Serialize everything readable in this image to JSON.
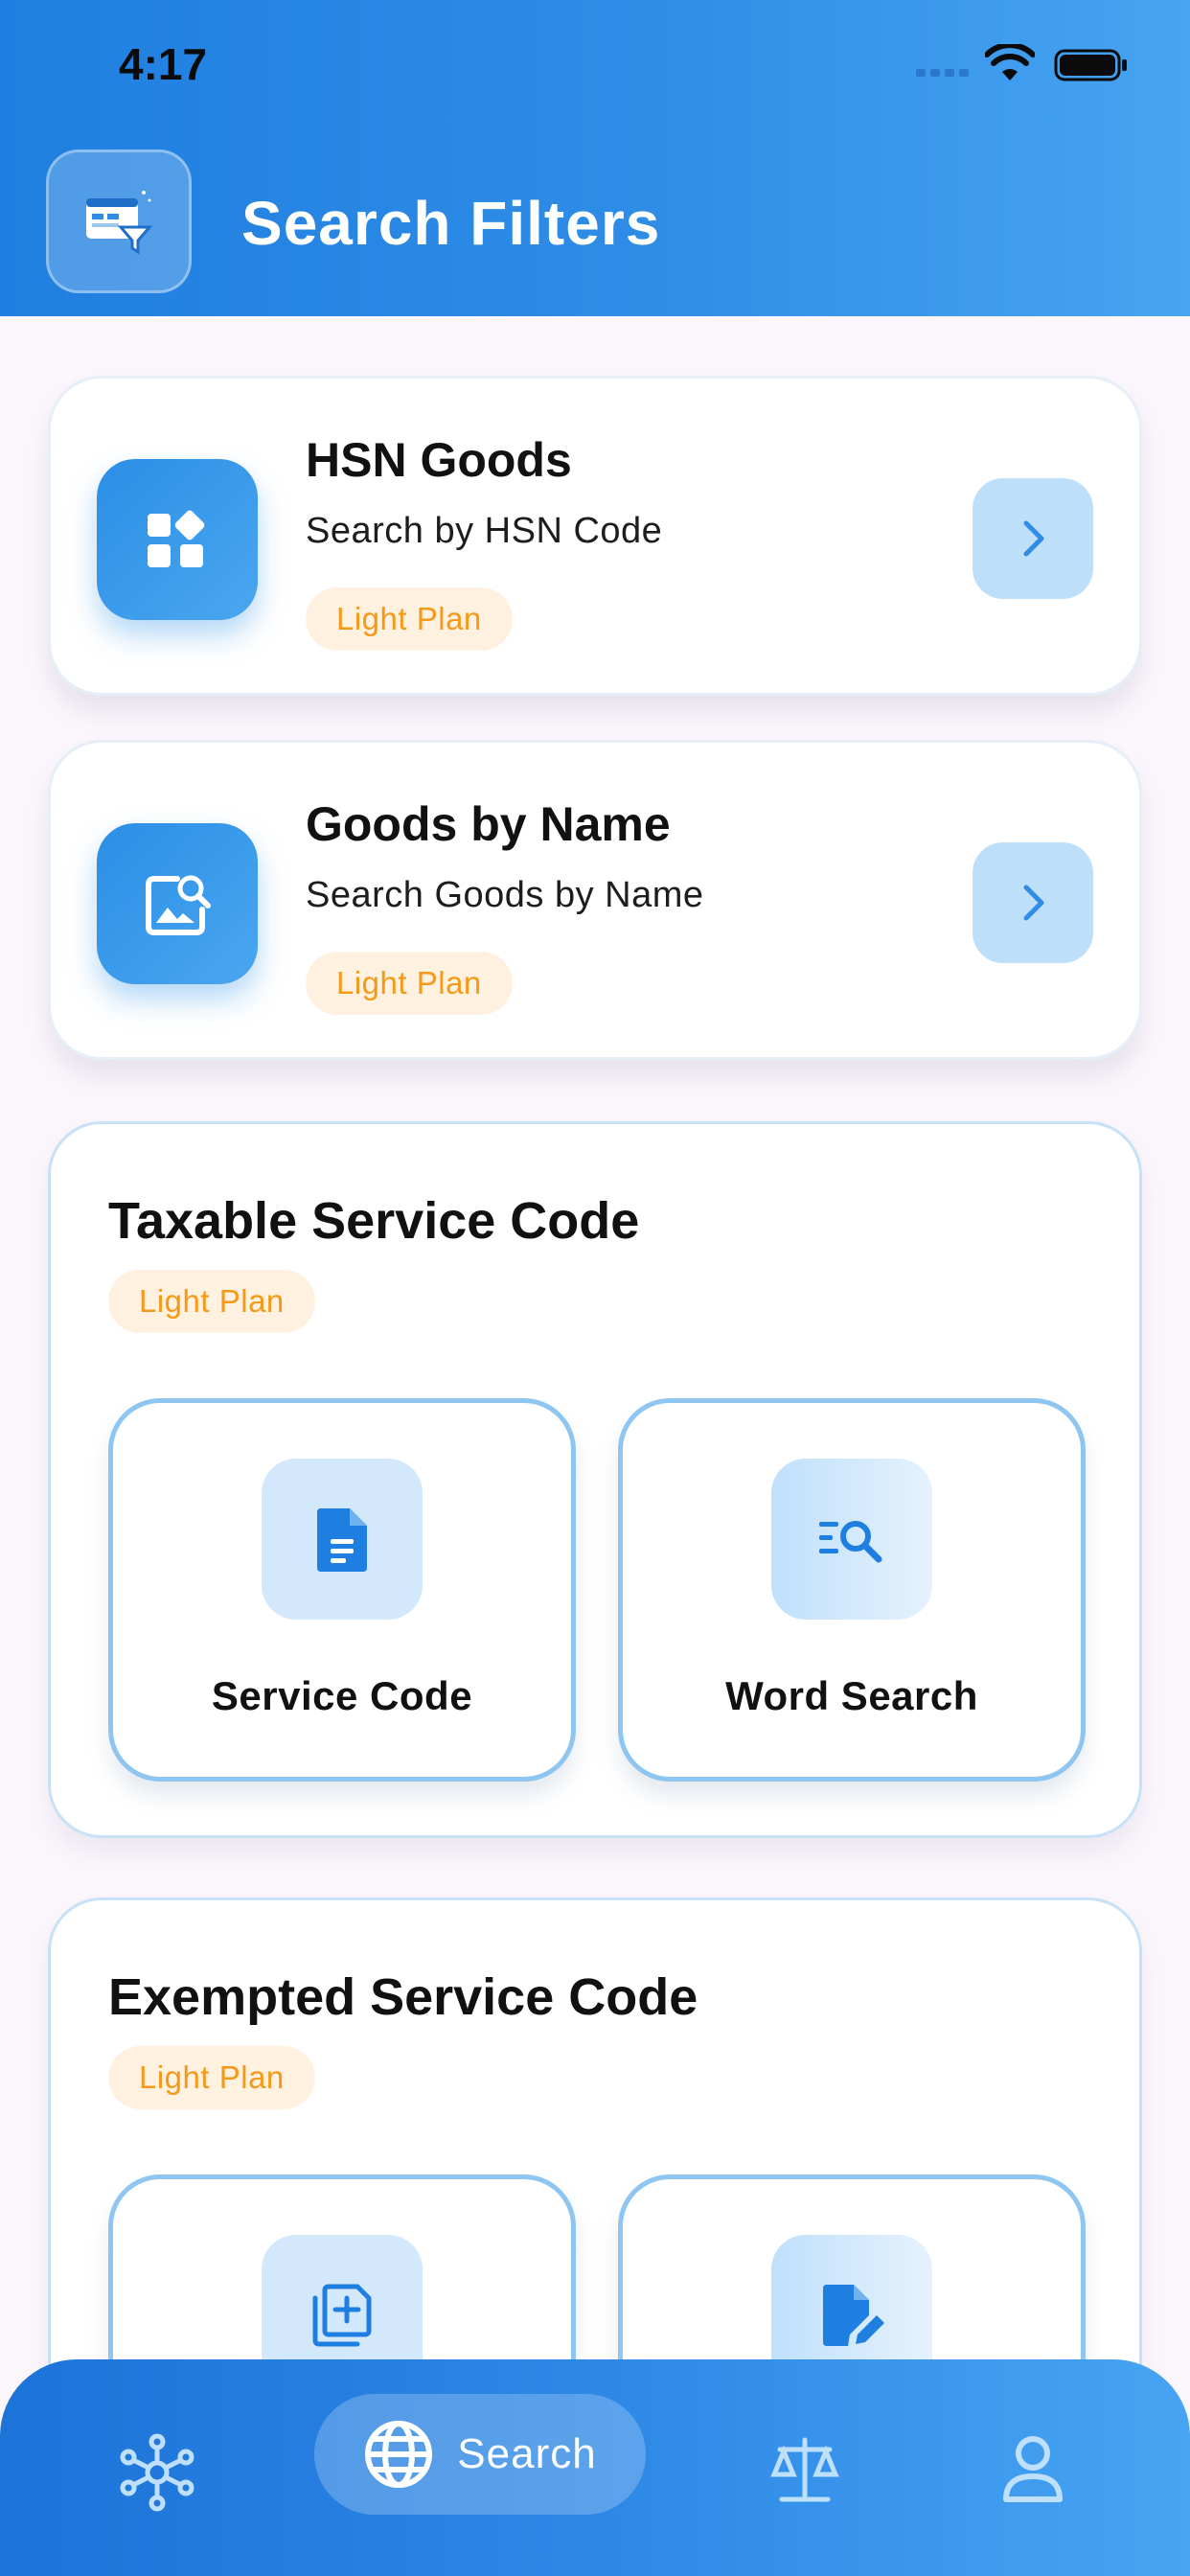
{
  "status_bar": {
    "time": "4:17"
  },
  "header": {
    "title": "Search Filters",
    "icon": "filter-browser-icon"
  },
  "cards": [
    {
      "title": "HSN Goods",
      "subtitle": "Search by HSN Code",
      "badge": "Light Plan",
      "icon": "widgets-icon"
    },
    {
      "title": "Goods by Name",
      "subtitle": "Search Goods by Name",
      "badge": "Light Plan",
      "icon": "image-search-icon"
    }
  ],
  "sections": [
    {
      "title": "Taxable Service Code",
      "badge": "Light Plan",
      "tiles": [
        {
          "label": "Service Code",
          "icon": "document-icon"
        },
        {
          "label": "Word Search",
          "icon": "text-search-icon"
        }
      ]
    },
    {
      "title": "Exempted Service Code",
      "badge": "Light Plan",
      "tiles": [
        {
          "label": "",
          "icon": "library-add-icon"
        },
        {
          "label": "",
          "icon": "edit-document-icon"
        }
      ]
    }
  ],
  "bottom_nav": {
    "items": [
      {
        "icon": "network-icon",
        "label": ""
      },
      {
        "icon": "globe-icon",
        "label": "Search",
        "active": true
      },
      {
        "icon": "scale-icon",
        "label": ""
      },
      {
        "icon": "profile-icon",
        "label": ""
      }
    ]
  },
  "colors": {
    "primary": "#2f8de6",
    "badge_bg": "#fff1e0",
    "badge_text": "#f49a18",
    "tile_border": "#8fc6f1"
  }
}
